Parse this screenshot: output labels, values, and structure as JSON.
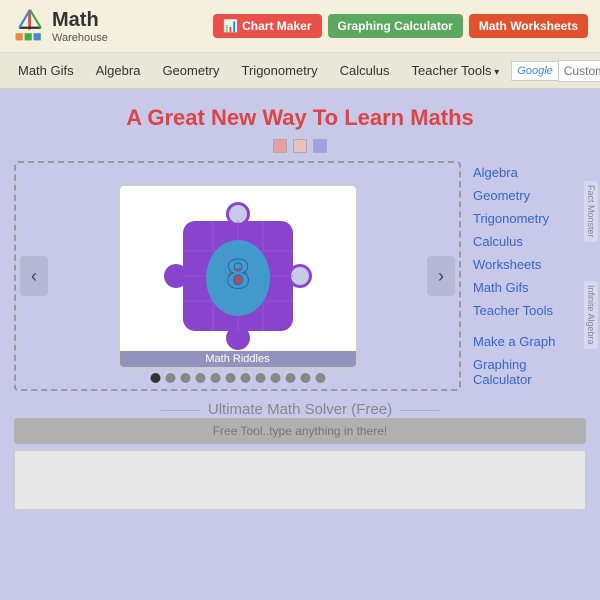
{
  "header": {
    "logo_text": "Math",
    "logo_sub": "Warehouse",
    "btn_chart": "Chart Maker",
    "btn_graph": "Graphing Calculator",
    "btn_worksheets": "Math Worksheets"
  },
  "nav": {
    "items": [
      {
        "label": "Math Gifs",
        "arrow": false
      },
      {
        "label": "Algebra",
        "arrow": false
      },
      {
        "label": "Geometry",
        "arrow": false
      },
      {
        "label": "Trigonometry",
        "arrow": false
      },
      {
        "label": "Calculus",
        "arrow": false
      },
      {
        "label": "Teacher Tools",
        "arrow": true
      }
    ],
    "search_placeholder": "Custom Search"
  },
  "page": {
    "title": "A Great New Way To Learn Maths",
    "carousel_caption": "Math Riddles",
    "carousel_prev": "‹",
    "carousel_next": "›",
    "color_dots": [
      "#e8a0a0",
      "#e8c0c0",
      "#a0a0e8"
    ],
    "indicators_count": 12,
    "active_indicator": 0
  },
  "sidebar": {
    "links": [
      "Algebra",
      "Geometry",
      "Trigonometry",
      "Calculus",
      "Worksheets",
      "Math Gifs",
      "Teacher Tools",
      "Make a Graph",
      "Graphing\nCalculator"
    ],
    "right_tab1": "Fact Monster",
    "right_tab2": "Infinite Algebra"
  },
  "solver": {
    "title_left": "———",
    "title_text": "Ultimate Math Solver (Free)",
    "title_right": "———",
    "input_placeholder": "Free Tool..type anything in there!"
  }
}
